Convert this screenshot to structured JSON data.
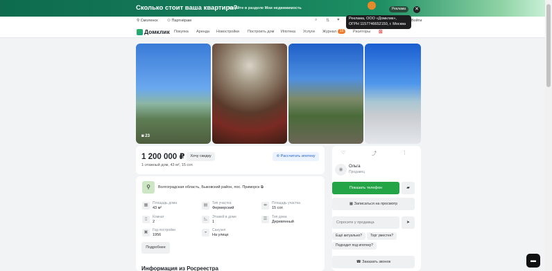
{
  "banner": {
    "title": "Сколько стоит ваша квартира?",
    "subtitle": "Узнайте в разделе Мои недвижимость",
    "ad_label": "Реклама",
    "close_icon": "close-icon"
  },
  "tooltip": {
    "line1": "Реклама, ООО «Домклик»,",
    "line2": "ОГРН 1157746652150, г. Москва"
  },
  "topbar": {
    "city": "Смоленск",
    "partners": "Партнёрам",
    "login": "Войти"
  },
  "nav": {
    "logo": "Домклик",
    "items": [
      "Покупка",
      "Аренда",
      "Новостройки",
      "Построить дом",
      "Ипотека",
      "Услуги",
      "Журнал",
      "Риэлторы"
    ],
    "journal_badge": "13"
  },
  "photos": {
    "count": "23"
  },
  "listing": {
    "price": "1 200 000 ₽",
    "cheap_button": "Хочу скидку",
    "description": "1-этажный дом, 43 м², 15 сот.",
    "mortgage_button": "Рассчитать ипотеку",
    "address": "Волгоградская область, Быковский район, пос. Приморск",
    "properties": [
      {
        "label": "Площадь дома",
        "value": "43 м²",
        "icon": "ruler-icon"
      },
      {
        "label": "Тип участка",
        "value": "Фермерский",
        "icon": "plot-icon"
      },
      {
        "label": "Площадь участка",
        "value": "15 сот.",
        "icon": "area-icon"
      },
      {
        "label": "Комнат",
        "value": "2",
        "icon": "door-icon"
      },
      {
        "label": "Этажей в доме",
        "value": "1",
        "icon": "stairs-icon"
      },
      {
        "label": "Тип дома",
        "value": "Деревянный",
        "icon": "wall-icon"
      },
      {
        "label": "Год постройки",
        "value": "1956",
        "icon": "calendar-icon"
      },
      {
        "label": "Санузел",
        "value": "На улице",
        "icon": "toilet-icon"
      }
    ],
    "more_button": "Подробнее",
    "section_title": "Информация из Росреестра"
  },
  "seller": {
    "name": "Ольга",
    "role": "Продавец",
    "phone_button": "Показать телефон",
    "view_button": "Записаться на просмотр",
    "ask_placeholder": "Спросите у продавца",
    "chips": [
      "Ещё актуально?",
      "Торг уместен?",
      "Подходит под ипотеку?"
    ],
    "call_button": "Заказать звонок"
  }
}
